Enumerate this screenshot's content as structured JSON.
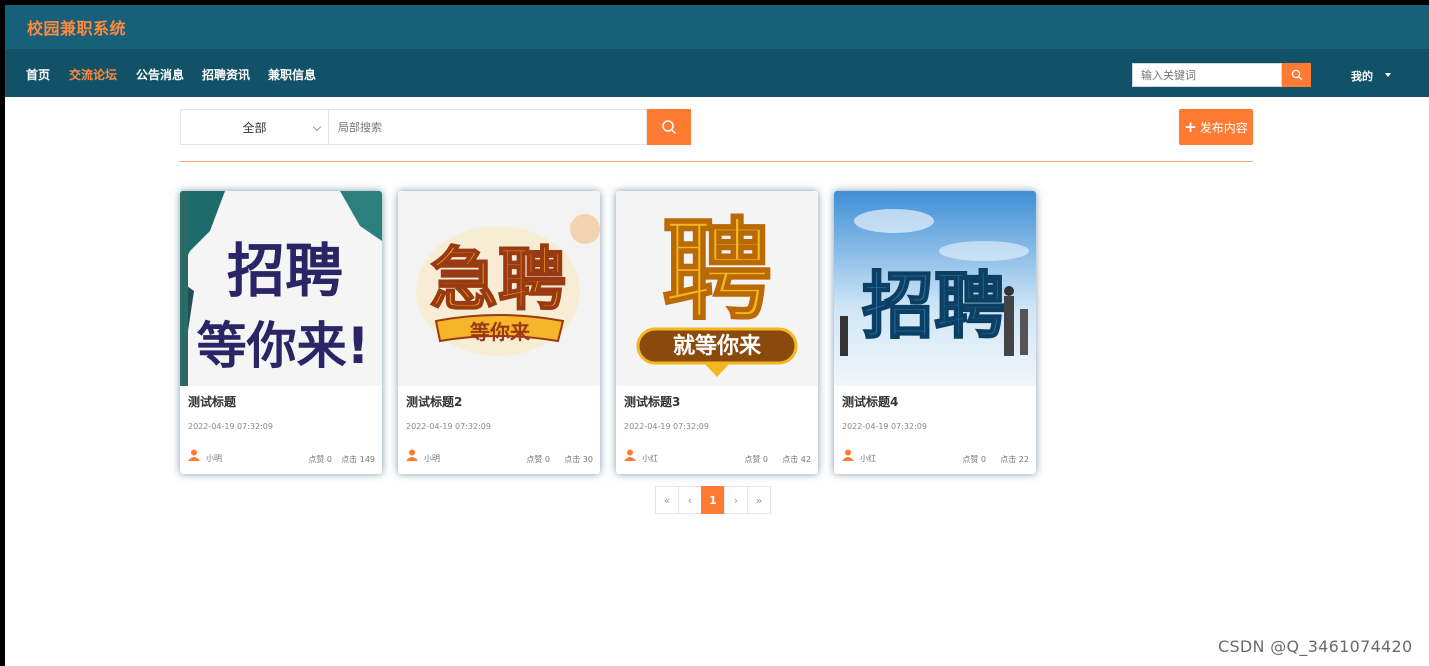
{
  "header": {
    "app_title": "校园兼职系统",
    "nav": [
      "首页",
      "交流论坛",
      "公告消息",
      "招聘资讯",
      "兼职信息"
    ],
    "active_nav": "交流论坛",
    "search_placeholder": "输入关键词",
    "user_menu": "我的"
  },
  "filter": {
    "category": "全部",
    "search_placeholder": "局部搜索",
    "publish_label": "发布内容",
    "publish_symbol": "+"
  },
  "cards": [
    {
      "title": "测试标题",
      "date": "2022-04-19 07:32:09",
      "author": "小明",
      "likes": "点赞 0",
      "clicks": "点击 149",
      "image_text_top": "招聘",
      "image_text_bottom": "等你来!"
    },
    {
      "title": "测试标题2",
      "date": "2022-04-19 07:32:09",
      "author": "小明",
      "likes": "点赞 0",
      "clicks": "点击 30",
      "image_text_top": "急聘",
      "image_text_bottom": "等你来"
    },
    {
      "title": "测试标题3",
      "date": "2022-04-19 07:32:09",
      "author": "小红",
      "likes": "点赞 0",
      "clicks": "点击 42",
      "image_text_top": "聘",
      "image_text_bottom": "就等你来"
    },
    {
      "title": "测试标题4",
      "date": "2022-04-19 07:32:09",
      "author": "小红",
      "likes": "点赞 0",
      "clicks": "点击 22",
      "image_text_top": "招聘",
      "image_text_bottom": ""
    }
  ],
  "pagination": {
    "first": "«",
    "prev": "‹",
    "current": "1",
    "next": "›",
    "last": "»"
  },
  "watermark": "CSDN @Q_3461074420",
  "colors": {
    "header_top": "#16607a",
    "header_nav": "#125268",
    "accent": "#ff7a33",
    "title_orange": "#ff8a3d"
  },
  "icons": [
    "search-icon",
    "caret-down-icon",
    "chevron-down-icon",
    "user-icon",
    "plus-icon"
  ]
}
